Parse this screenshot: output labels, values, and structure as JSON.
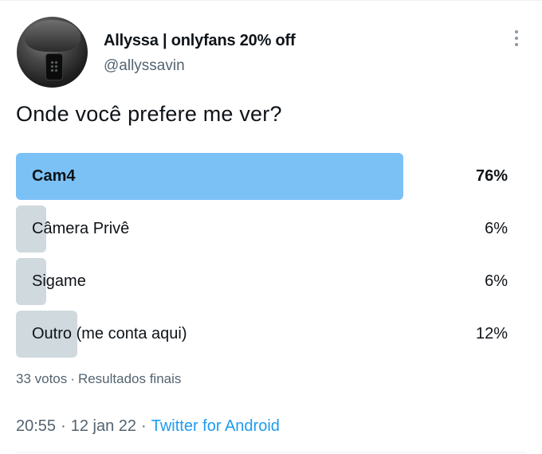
{
  "author": {
    "display_name": "Allyssa | onlyfans 20% off",
    "handle": "@allyssavin",
    "avatar": "profile-photo"
  },
  "tweet": {
    "text": "Onde você prefere me ver?"
  },
  "poll": {
    "options": [
      {
        "label": "Cam4",
        "percent_text": "76%",
        "share": 0.76,
        "leading": true
      },
      {
        "label": "Câmera Privê",
        "percent_text": "6%",
        "share": 0.06,
        "leading": false
      },
      {
        "label": "Sigame",
        "percent_text": "6%",
        "share": 0.06,
        "leading": false
      },
      {
        "label": "Outro (me conta aqui)",
        "percent_text": "12%",
        "share": 0.12,
        "leading": false
      }
    ],
    "votes": "33 votos",
    "separator": "·",
    "status": "Resultados finais"
  },
  "meta": {
    "time": "20:55",
    "separator": "·",
    "date": "12 jan 22",
    "source": "Twitter for Android"
  },
  "colors": {
    "leading_bar": "#7cc1f6",
    "other_bar": "#cfd9de",
    "link": "#1d9bf0",
    "secondary_text": "#536471"
  },
  "icons": {
    "more": "more-vertical-icon"
  }
}
